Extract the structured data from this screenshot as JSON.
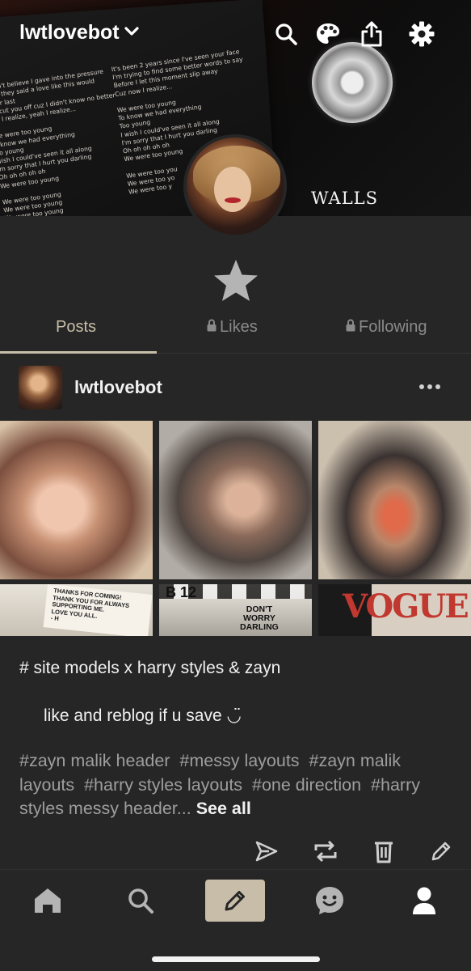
{
  "header": {
    "blog_name": "lwtlovebot",
    "lyrics_left": "s\nI can't believe I gave into the pressure\nhen they said a love like this would\never last\no I cut you off cuz I didn't know no better\now I realize, yeah I realize...\n\nWe were too young\no know we had everything\noo young\nwish I could've seen it all along\n'm sorry that I hurt you darling\nOh oh oh oh oh\nWe were too young\n\nWe were too young\nWe were too young\nWe were too young",
    "lyrics_right": "It's been 2 years since I've seen your face\nI'm trying to find some better words to say\nBefore I let this moment slip away\nCuz now I realize...\n\nWe were too young\nTo know we had everything\nToo young\nI wish I could've seen it all along\nI'm sorry that I hurt you darling\nOh oh oh oh oh\nWe were too young\n\nWe were too you\nWe were too yo\nWe were too y",
    "album_text": "WALLS"
  },
  "tabs": [
    {
      "label": "Posts",
      "active": true
    },
    {
      "label": "Likes",
      "locked": true
    },
    {
      "label": "Following",
      "locked": true
    }
  ],
  "post": {
    "author": "lwtlovebot",
    "photos": {
      "note_text": "THANKS FOR COMING!\nTHANK YOU FOR ALWAYS\nSUPPORTING ME.\nLOVE YOU ALL.\n- H",
      "clapper_text": "DON'T\nWORRY\nDARLING",
      "clapper_number": "B 12",
      "magazine_text": "VOGUE"
    },
    "title": "# site models x harry styles & zayn",
    "body": "like and reblog if u save ◡̈",
    "tags": [
      "#zayn malik header",
      "#messy layouts",
      "#zayn malik layouts",
      "#harry styles layouts",
      "#one direction",
      "#harry styles messy header..."
    ],
    "see_all": "See all"
  },
  "colors": {
    "background": "#262626",
    "accent": "#c8bda9",
    "inactive_tab": "#8a8a8a",
    "tag_text": "#9e9e9e"
  },
  "icons": {
    "top_bar": [
      "chevron-down-icon",
      "search-icon",
      "palette-icon",
      "share-icon",
      "gear-icon"
    ],
    "post_actions": [
      "send-icon",
      "reblog-icon",
      "delete-icon",
      "edit-icon"
    ],
    "bottom_nav": [
      "home-icon",
      "search-icon",
      "compose-pencil-icon",
      "chat-icon",
      "account-icon"
    ]
  }
}
